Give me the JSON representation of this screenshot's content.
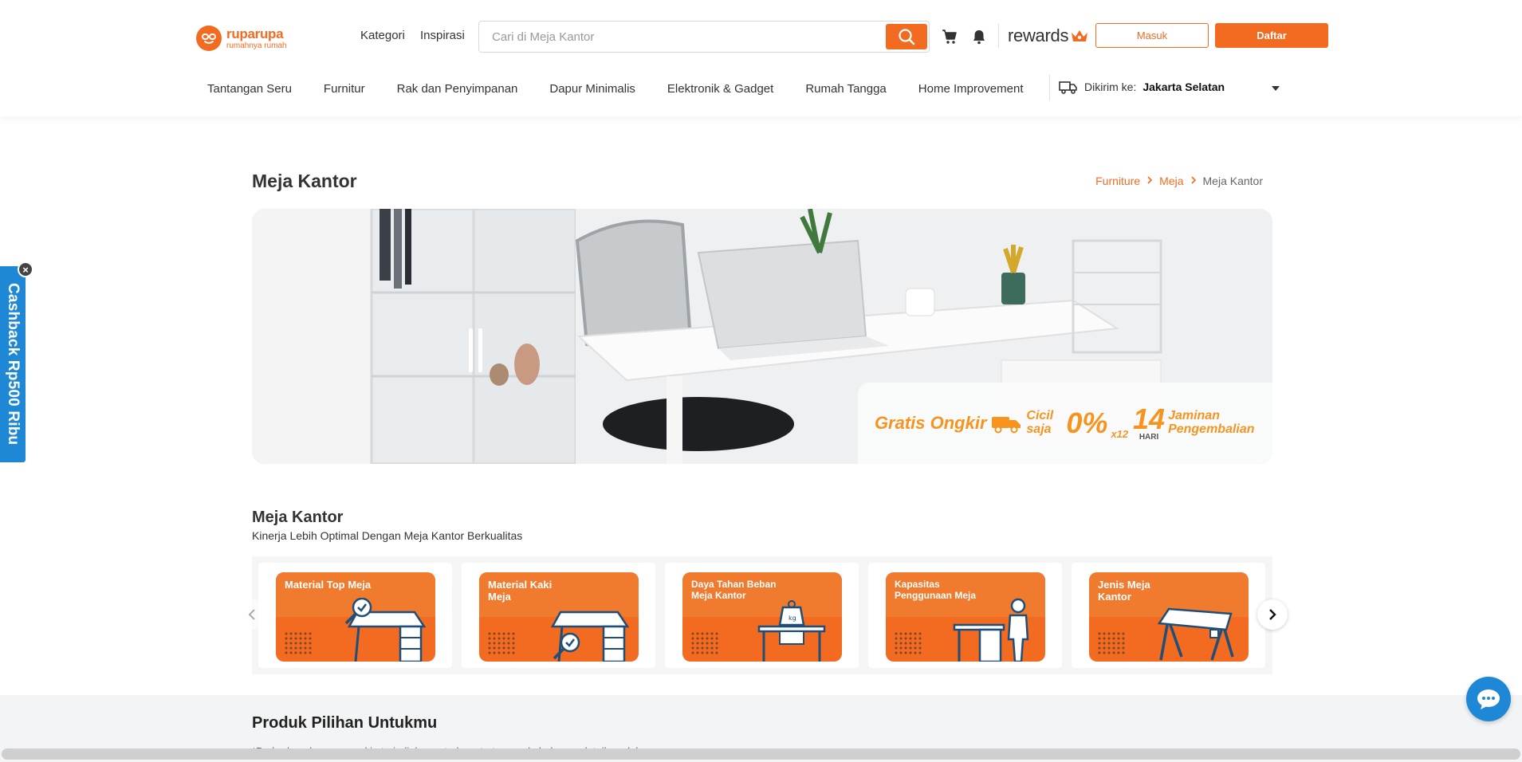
{
  "header": {
    "logo_name": "ruparupa",
    "logo_tagline": "rumahnya rumah",
    "kategori": "Kategori",
    "inspirasi": "Inspirasi",
    "search_placeholder": "Cari di Meja Kantor",
    "rewards": "rewards",
    "masuk": "Masuk",
    "daftar": "Daftar",
    "accent_color": "#f26b21"
  },
  "nav": {
    "items": [
      "Tantangan Seru",
      "Furnitur",
      "Rak dan Penyimpanan",
      "Dapur Minimalis",
      "Elektronik & Gadget",
      "Rumah Tangga",
      "Home Improvement"
    ],
    "deliver_label": "Dikirim ke:",
    "deliver_city": "Jakarta Selatan"
  },
  "cashback": {
    "label": "Cashback Rp500 Ribu",
    "close": "×",
    "color": "#1e88d6"
  },
  "page": {
    "title": "Meja Kantor",
    "breadcrumb": [
      "Furniture",
      "Meja",
      "Meja Kantor"
    ]
  },
  "banner": {
    "promo_1": "Gratis Ongkir",
    "promo_2_small": "Cicil saja",
    "promo_2_big": "0%",
    "promo_2_sub": "x12",
    "promo_3_big": "14",
    "promo_3_sub": "HARI",
    "promo_3_text": "Jaminan Pengembalian"
  },
  "section": {
    "title": "Meja Kantor",
    "subtitle": "Kinerja Lebih Optimal Dengan Meja Kantor Berkualitas",
    "cards": [
      {
        "label": "Material Top Meja",
        "icon": "desk-magnifier-icon"
      },
      {
        "label": "Material Kaki Meja",
        "icon": "desk-leg-magnifier-icon"
      },
      {
        "label": "Daya Tahan Beban Meja Kantor",
        "icon": "desk-weight-icon"
      },
      {
        "label": "Kapasitas Penggunaan Meja",
        "icon": "desk-person-icon"
      },
      {
        "label": "Jenis Meja Kantor",
        "icon": "table-icon"
      }
    ]
  },
  "products": {
    "title": "Produk Pilihan Untukmu",
    "note": "*Perbedaan harga mungkin terjadi, harga terbaru tertera pada halaman detail produk"
  }
}
